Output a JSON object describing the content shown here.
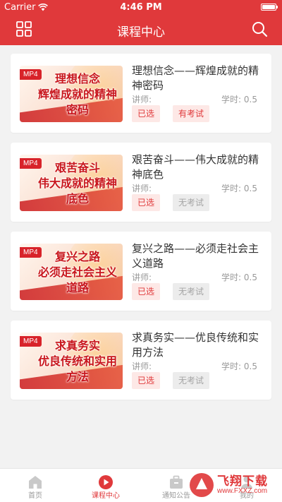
{
  "status": {
    "carrier": "Carrier",
    "time": "4:46 PM"
  },
  "nav": {
    "title": "课程中心",
    "left_icon": "grid-icon",
    "right_icon": "search-icon"
  },
  "courses": [
    {
      "badge": "MP4",
      "thumb_text": "理想信念\n辉煌成就的精神\n密码",
      "title": "理想信念——辉煌成就的精神密码",
      "lecturer_label": "讲师:",
      "hours_label": "学时:",
      "hours": "0.5",
      "selected_label": "已选",
      "exam_label": "有考试",
      "has_exam": true
    },
    {
      "badge": "MP4",
      "thumb_text": "艰苦奋斗\n伟大成就的精神\n底色",
      "title": "艰苦奋斗——伟大成就的精神底色",
      "lecturer_label": "讲师:",
      "hours_label": "学时:",
      "hours": "0.5",
      "selected_label": "已选",
      "exam_label": "无考试",
      "has_exam": false
    },
    {
      "badge": "MP4",
      "thumb_text": "复兴之路\n必须走社会主义\n道路",
      "title": "复兴之路——必须走社会主义道路",
      "lecturer_label": "讲师:",
      "hours_label": "学时:",
      "hours": "0.5",
      "selected_label": "已选",
      "exam_label": "无考试",
      "has_exam": false
    },
    {
      "badge": "MP4",
      "thumb_text": "求真务实\n优良传统和实用\n方法",
      "title": "求真务实——优良传统和实用方法",
      "lecturer_label": "讲师:",
      "hours_label": "学时:",
      "hours": "0.5",
      "selected_label": "已选",
      "exam_label": "无考试",
      "has_exam": false
    }
  ],
  "tabs": [
    {
      "label": "首页",
      "icon": "home-icon",
      "active": false
    },
    {
      "label": "课程中心",
      "icon": "play-icon",
      "active": true
    },
    {
      "label": "通知公告",
      "icon": "briefcase-icon",
      "active": false
    },
    {
      "label": "我的",
      "icon": "user-icon",
      "active": false
    }
  ],
  "watermark": {
    "text": "飞翔下载",
    "url": "www.FXXZ.com"
  },
  "colors": {
    "primary": "#e0393b",
    "tag_bg": "#fde8e6",
    "disabled_bg": "#ececec",
    "page_bg": "#f2f2f2"
  }
}
